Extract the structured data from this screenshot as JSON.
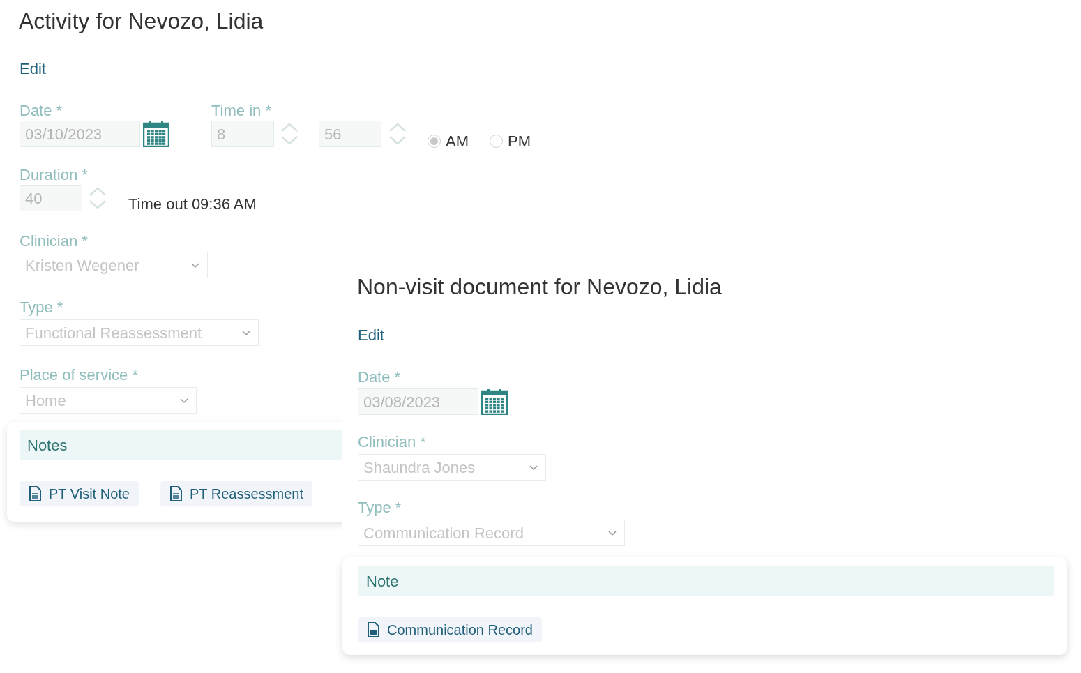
{
  "activity": {
    "title": "Activity for Nevozo, Lidia",
    "edit_link": "Edit",
    "date": {
      "label": "Date *",
      "value": "03/10/2023"
    },
    "time_in": {
      "label": "Time in *",
      "hour": "8",
      "minute": "56"
    },
    "meridiem": [
      {
        "label": "AM",
        "selected": true
      },
      {
        "label": "PM",
        "selected": false
      }
    ],
    "duration": {
      "label": "Duration *",
      "value": "40"
    },
    "time_out": "Time out 09:36 AM",
    "clinician": {
      "label": "Clinician *",
      "value": "Kristen Wegener"
    },
    "type": {
      "label": "Type *",
      "value": "Functional Reassessment"
    },
    "place_of_service": {
      "label": "Place of service *",
      "value": "Home"
    },
    "notes": {
      "title": "Notes",
      "documents": [
        {
          "label": "PT Visit Note",
          "kind": "document"
        },
        {
          "label": "PT Reassessment",
          "kind": "document"
        }
      ]
    }
  },
  "non_visit": {
    "title": "Non-visit document for Nevozo, Lidia",
    "edit_link": "Edit",
    "date": {
      "label": "Date *",
      "value": "03/08/2023"
    },
    "clinician": {
      "label": "Clinician *",
      "value": "Shaundra Jones"
    },
    "type": {
      "label": "Type *",
      "value": "Communication Record"
    },
    "note": {
      "title": "Note",
      "documents": [
        {
          "label": "Communication Record",
          "kind": "pdf"
        }
      ]
    }
  }
}
